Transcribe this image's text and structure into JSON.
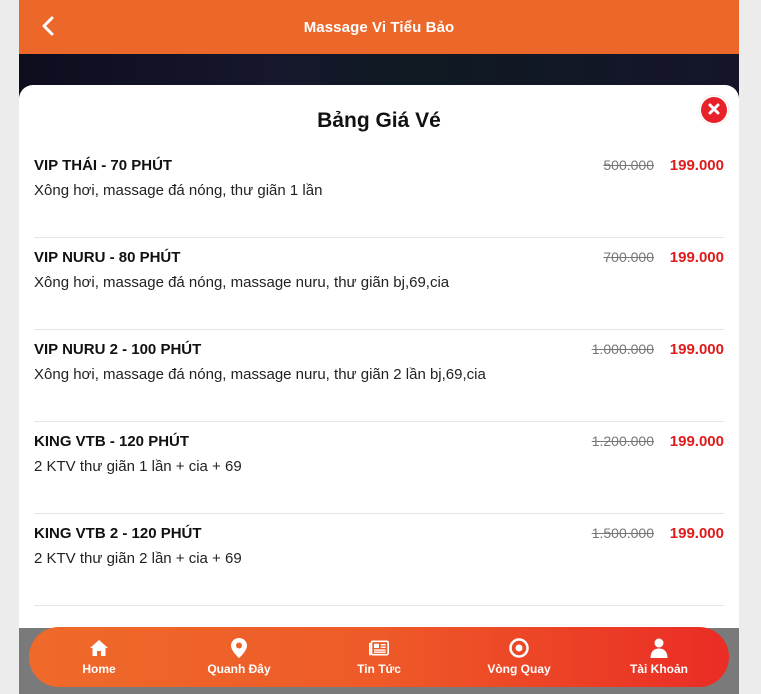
{
  "header": {
    "title": "Massage Vi Tiểu Bảo",
    "back_icon": "chevron-left-icon"
  },
  "modal": {
    "title": "Bảng Giá Vé",
    "close_icon": "close-icon",
    "items": [
      {
        "name": "VIP THÁI - 70 PHÚT",
        "desc": "Xông hơi, massage đá nóng, thư giãn 1 lần",
        "old_price": "500.000",
        "new_price": "199.000"
      },
      {
        "name": "VIP NURU - 80 PHÚT",
        "desc": "Xông hơi, massage đá nóng, massage nuru, thư giãn bj,69,cia",
        "old_price": "700.000",
        "new_price": "199.000"
      },
      {
        "name": "VIP NURU 2 - 100 PHÚT",
        "desc": "Xông hơi, massage đá nóng, massage nuru, thư giãn 2 lần bj,69,cia",
        "old_price": "1.000.000",
        "new_price": "199.000"
      },
      {
        "name": "KING VTB - 120 PHÚT",
        "desc": "2 KTV thư giãn 1 lần + cia + 69",
        "old_price": "1.200.000",
        "new_price": "199.000"
      },
      {
        "name": "KING VTB 2 - 120 PHÚT",
        "desc": "2 KTV thư giãn 2 lần + cia + 69",
        "old_price": "1.500.000",
        "new_price": "199.000"
      }
    ]
  },
  "nav": {
    "items": [
      {
        "label": "Home",
        "icon": "home-icon"
      },
      {
        "label": "Quanh Đây",
        "icon": "map-pin-icon"
      },
      {
        "label": "Tin Tức",
        "icon": "newspaper-icon"
      },
      {
        "label": "Vòng Quay",
        "icon": "target-icon"
      },
      {
        "label": "Tài Khoản",
        "icon": "user-icon"
      }
    ]
  },
  "colors": {
    "accent": "#ec672a",
    "price": "#e01b1b",
    "close": "#e8202a"
  }
}
